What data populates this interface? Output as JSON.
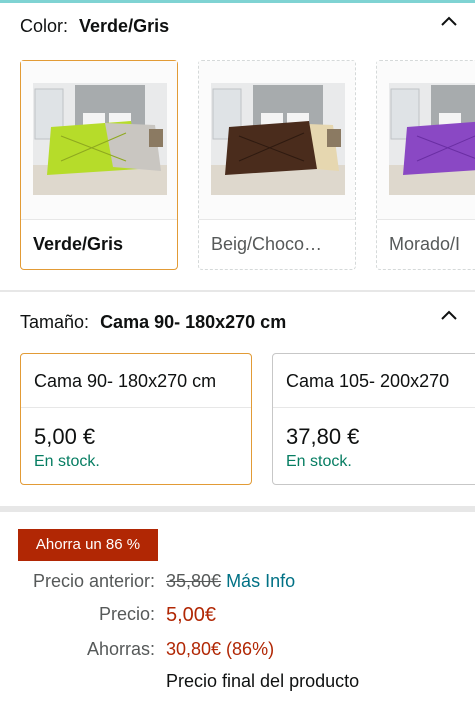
{
  "color": {
    "label": "Color:",
    "selected": "Verde/Gris",
    "options": [
      {
        "label": "Verde/Gris",
        "comforter": "#b6dc2a",
        "accent": "#c9c6c1"
      },
      {
        "label": "Beig/Choco…",
        "comforter": "#4a2c1c",
        "accent": "#e6d7b0"
      },
      {
        "label": "Morado/I",
        "comforter": "#8a48c4",
        "accent": "#b9b4b8"
      }
    ]
  },
  "size": {
    "label": "Tamaño:",
    "selected": "Cama 90- 180x270 cm",
    "options": [
      {
        "name": "Cama 90- 180x270 cm",
        "price": "5,00 €",
        "stock": "En stock."
      },
      {
        "name": "Cama 105- 200x270",
        "price": "37,80 €",
        "stock": "En stock."
      }
    ]
  },
  "pricing": {
    "badge": "Ahorra un 86 %",
    "prev_label": "Precio anterior:",
    "prev_value": "35,80€",
    "more_info": "Más Info",
    "price_label": "Precio:",
    "price_value": "5,00€",
    "savings_label": "Ahorras:",
    "savings_value": "30,80€ (86%)",
    "final_note": "Precio final del producto"
  },
  "colors": {
    "selected_border": "#e29b36",
    "price_red": "#b12704",
    "stock_green": "#067d62",
    "link": "#007185"
  }
}
